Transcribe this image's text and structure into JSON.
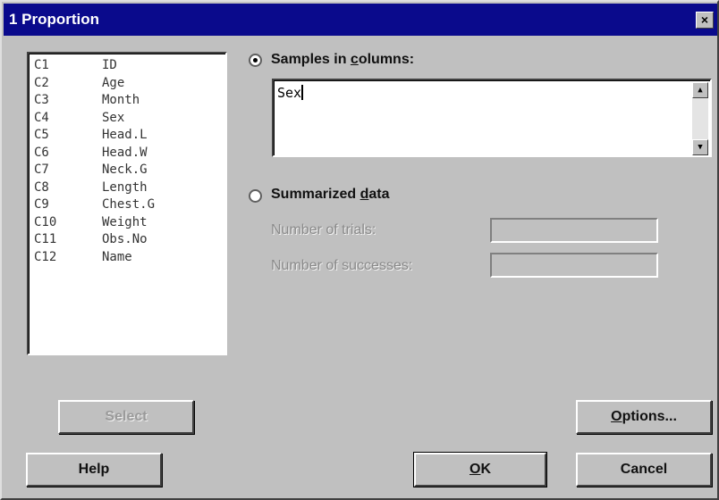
{
  "window": {
    "title": "1 Proportion",
    "close_label": "×"
  },
  "columns": [
    {
      "id": "C1",
      "name": "ID"
    },
    {
      "id": "C2",
      "name": "Age"
    },
    {
      "id": "C3",
      "name": "Month"
    },
    {
      "id": "C4",
      "name": "Sex"
    },
    {
      "id": "C5",
      "name": "Head.L"
    },
    {
      "id": "C6",
      "name": "Head.W"
    },
    {
      "id": "C7",
      "name": "Neck.G"
    },
    {
      "id": "C8",
      "name": "Length"
    },
    {
      "id": "C9",
      "name": "Chest.G"
    },
    {
      "id": "C10",
      "name": "Weight"
    },
    {
      "id": "C11",
      "name": "Obs.No"
    },
    {
      "id": "C12",
      "name": "Name"
    }
  ],
  "samples": {
    "label_pre": "Samples in ",
    "label_accel": "c",
    "label_post": "olumns:",
    "selected": true,
    "value": "Sex"
  },
  "summarized": {
    "label_pre": "Summarized ",
    "label_accel": "d",
    "label_post": "ata",
    "selected": false,
    "trials_label": "Number of trials:",
    "trials_value": "",
    "successes_label": "Number of successes:",
    "successes_value": ""
  },
  "buttons": {
    "select": "Select",
    "options_accel": "O",
    "options_post": "ptions...",
    "help": "Help",
    "ok_accel": "O",
    "ok_post": "K",
    "cancel": "Cancel"
  }
}
